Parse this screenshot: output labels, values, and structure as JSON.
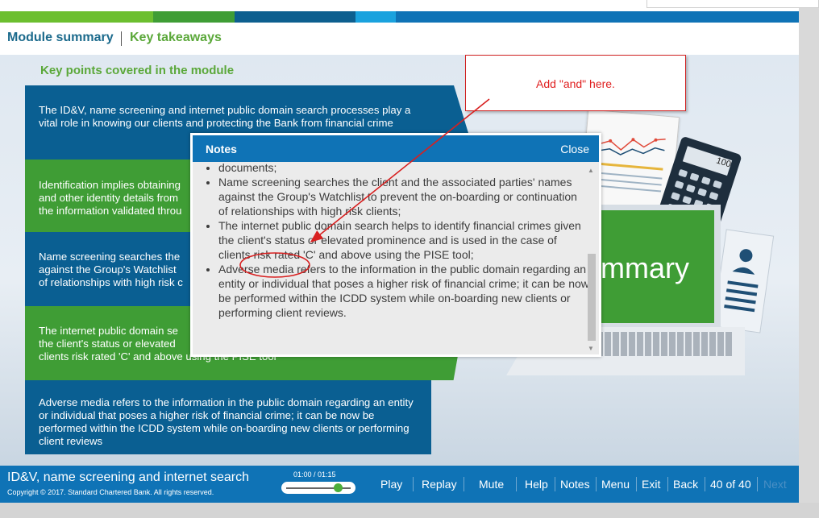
{
  "tabs": {
    "summary": "Module summary",
    "takeaways": "Key takeaways"
  },
  "content": {
    "heading": "Key points covered in the module",
    "slabs": [
      "The ID&V, name screening and internet public domain search processes play a vital role in knowing our clients and protecting the Bank from financial crime",
      "Identification implies obtaining\nand other identity details from\nthe information validated throu",
      "Name screening searches the\nagainst the Group's Watchlist\nof relationships with high risk c",
      "The internet public domain se\nthe client's status or elevated\nclients risk rated 'C' and above using the PISE tool",
      "Adverse media refers to the information in the public domain regarding an entity or individual that poses a higher risk of financial crime; it can be now be performed within the ICDD system while on-boarding new clients or performing client reviews"
    ],
    "summary_word": "mmary",
    "calculator_display": "100"
  },
  "notes": {
    "title": "Notes",
    "close": "Close",
    "items": [
      "documents;",
      "Name screening searches the client and the associated parties' names against the Group's Watchlist to prevent the on-boarding or continuation of relationships with high risk clients;",
      "The internet public domain search helps to identify financial crimes given the client's status or elevated prominence and is used in the case of clients risk rated 'C' and above using the PISE tool;",
      "Adverse media refers to the information in the public domain regarding an entity or individual that poses a higher risk of financial crime; it can be now be performed within the ICDD system while on-boarding new clients or performing client reviews."
    ]
  },
  "annotation": {
    "text": "Add \"and\" here.",
    "color": "#e02020"
  },
  "footer": {
    "course_title": "ID&V, name screening and internet search",
    "copyright": "Copyright © 2017. Standard Chartered Bank. All rights reserved.",
    "time": "01:00 / 01:15",
    "progress": 0.8,
    "buttons": {
      "play": "Play",
      "replay": "Replay",
      "mute": "Mute",
      "help": "Help",
      "notes": "Notes",
      "menu": "Menu",
      "exit": "Exit",
      "back": "Back",
      "page": "40 of 40",
      "next": "Next"
    }
  },
  "colors": {
    "brand_blue": "#0f73b6",
    "brand_green": "#5ba83a",
    "slab_blue": "#0a5f92",
    "slab_green": "#3f9d35"
  }
}
